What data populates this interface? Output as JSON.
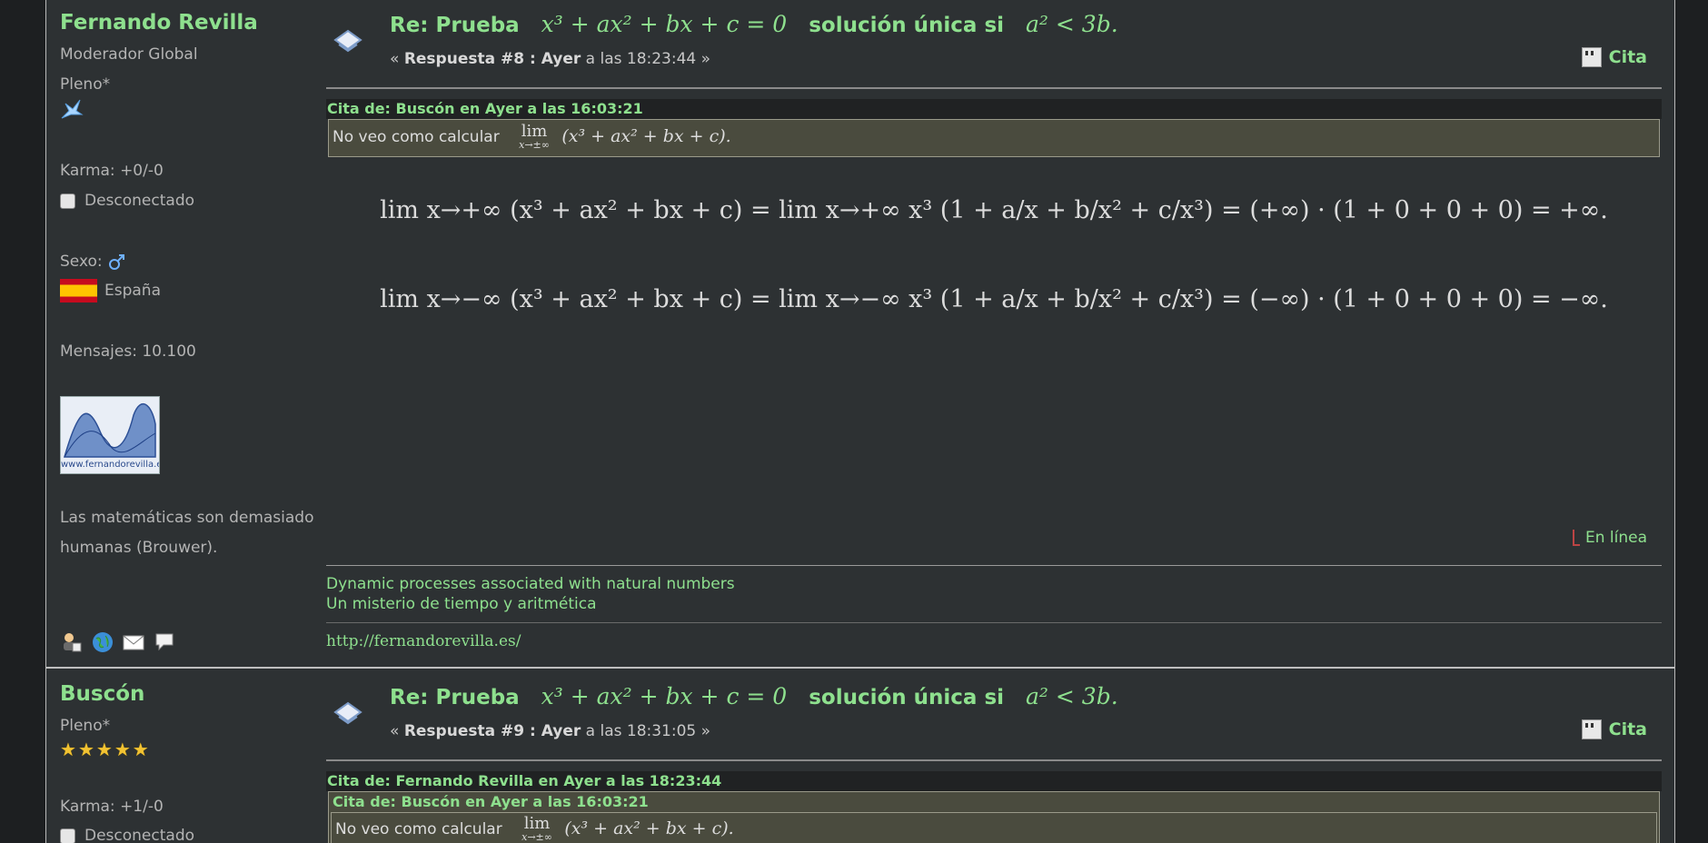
{
  "posts": [
    {
      "poster": {
        "name": "Fernando Revilla",
        "role": "Moderador Global",
        "rank": "Pleno*",
        "karma": "Karma: +0/-0",
        "status": "Desconectado",
        "sexo_label": "Sexo:",
        "country": "España",
        "messages": "Mensajes: 10.100",
        "avatar_text": "www.fernandorevilla.es",
        "signature_text_1": "Las matemáticas son demasiado",
        "signature_text_2": "humanas (Brouwer)."
      },
      "subject_prefix": "Re: Prueba",
      "subject_math_1": "x³ + ax² + bx + c = 0",
      "subject_mid": "solución única si",
      "subject_math_2": "a² < 3b.",
      "reply_open": "«",
      "reply_label": "Respuesta #8 : Ayer",
      "reply_time": "a las 18:23:44",
      "reply_close": "»",
      "cite_label": "Cita",
      "quote_header": "Cita de: Buscón en Ayer a las 16:03:21",
      "quote_text": "No veo como calcular",
      "quote_lim_top": "lim",
      "quote_lim_bottom": "x→±∞",
      "quote_expr": "(x³ + ax² + bx + c).",
      "formula_1": "lim x→+∞ (x³ + ax² + bx + c) = lim x→+∞ x³ (1 + a/x + b/x² + c/x³) = (+∞) · (1 + 0 + 0 + 0) = +∞.",
      "formula_2": "lim x→−∞ (x³ + ax² + bx + c) = lim x→−∞ x³ (1 + a/x + b/x² + c/x³) = (−∞) · (1 + 0 + 0 + 0) = −∞.",
      "online_label": "En línea",
      "sig_link_1": "Dynamic processes associated with natural numbers",
      "sig_link_2": "Un misterio de tiempo y aritmética",
      "sig_url": "http://fernandorevilla.es/"
    },
    {
      "poster": {
        "name": "Buscón",
        "rank": "Pleno*",
        "karma": "Karma: +1/-0",
        "status": "Desconectado"
      },
      "subject_prefix": "Re: Prueba",
      "subject_math_1": "x³ + ax² + bx + c = 0",
      "subject_mid": "solución única si",
      "subject_math_2": "a² < 3b.",
      "reply_open": "«",
      "reply_label": "Respuesta #9 : Ayer",
      "reply_time": "a las 18:31:05",
      "reply_close": "»",
      "cite_label": "Cita",
      "quote_header": "Cita de: Fernando Revilla en Ayer a las 18:23:44",
      "nested_quote_header": "Cita de: Buscón en Ayer a las 16:03:21",
      "quote_text": "No veo como calcular",
      "quote_lim_top": "lim",
      "quote_lim_bottom": "x→±∞",
      "quote_expr": "(x³ + ax² + bx + c)."
    }
  ]
}
